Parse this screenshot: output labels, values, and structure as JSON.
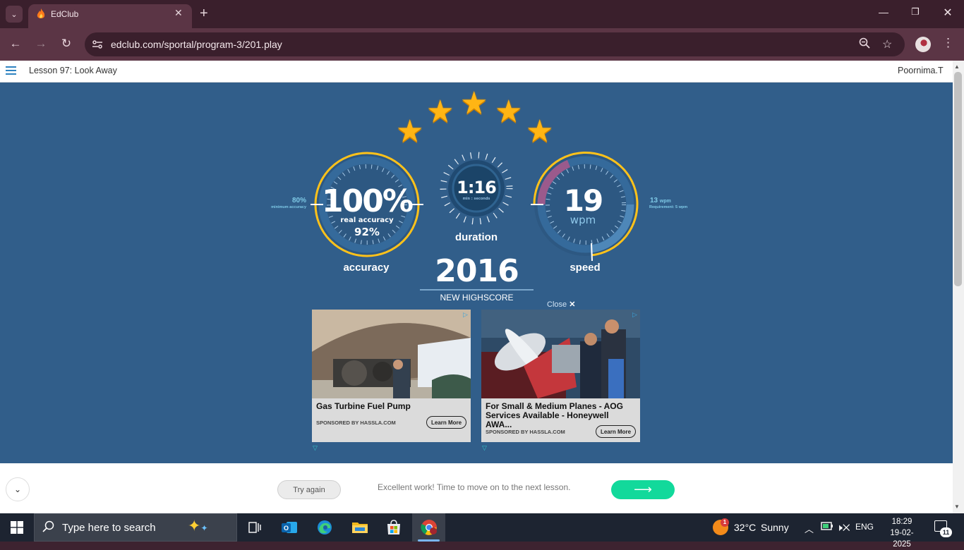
{
  "browser": {
    "tab_title": "EdClub",
    "url": "edclub.com/sportal/program-3/201.play"
  },
  "page": {
    "lesson_title": "Lesson 97: Look Away",
    "username": "Poornima.T"
  },
  "results": {
    "stars": 5,
    "accuracy": {
      "value": "100%",
      "real_label": "real accuracy",
      "real_value": "92%",
      "label": "accuracy",
      "minimum_value": "80%",
      "minimum_label": "minimum accuracy"
    },
    "duration": {
      "value": "1:16",
      "unit_label": "min : seconds",
      "label": "duration"
    },
    "speed": {
      "value": "19",
      "unit": "wpm",
      "label": "speed",
      "requirement_value": "13",
      "requirement_unit": "wpm",
      "requirement_label": "Requirement: 5 wpm"
    },
    "score": "2016",
    "score_label": "NEW HIGHSCORE"
  },
  "ads": {
    "close_label": "Close",
    "items": [
      {
        "title": "Gas Turbine Fuel Pump",
        "sponsor": "SPONSORED BY HASSLA.COM",
        "button": "Learn More"
      },
      {
        "title": "For Small & Medium Planes - AOG Services Available - Honeywell AWA...",
        "sponsor": "SPONSORED BY HASSLA.COM",
        "button": "Learn More"
      }
    ]
  },
  "footer": {
    "retry_label": "Try again",
    "message": "Excellent work! Time to move on to the next lesson.",
    "next_icon": "arrow-right-icon"
  },
  "taskbar": {
    "search_placeholder": "Type here to search",
    "weather_temp": "32°C",
    "weather_text": "Sunny",
    "weather_badge": "1",
    "language": "ENG",
    "time": "18:29",
    "date": "19-02-2025",
    "notification_count": "11"
  },
  "colors": {
    "stage": "#315e8a",
    "gold": "#ffc21a",
    "accent_next": "#12d99b",
    "tab_bg": "#5b3545"
  }
}
